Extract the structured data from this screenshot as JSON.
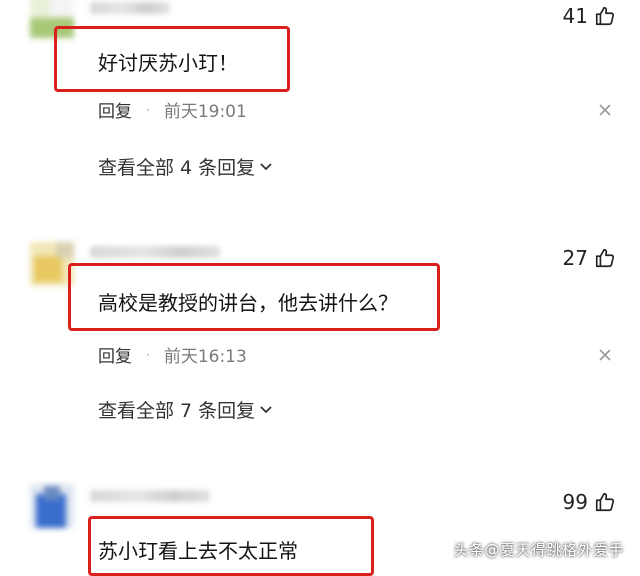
{
  "comments": [
    {
      "likes": "41",
      "text": "好讨厌苏小玎！",
      "reply_label": "回复",
      "dot": "·",
      "time": "前天19:01",
      "view_replies": "查看全部 4 条回复"
    },
    {
      "likes": "27",
      "text": "高校是教授的讲台，他去讲什么？",
      "reply_label": "回复",
      "dot": "·",
      "time": "前天16:13",
      "view_replies": "查看全部 7 条回复"
    },
    {
      "likes": "99",
      "text": "苏小玎看上去不太正常"
    }
  ],
  "watermark": "头条@夏天得跳格外爱手",
  "colors": {
    "highlight_box": "#d9201c",
    "text": "#141414",
    "meta": "#7a7a7a"
  },
  "icons": {
    "like": "thumbs-up-icon",
    "close": "close-icon",
    "expand": "chevron-down-icon"
  }
}
